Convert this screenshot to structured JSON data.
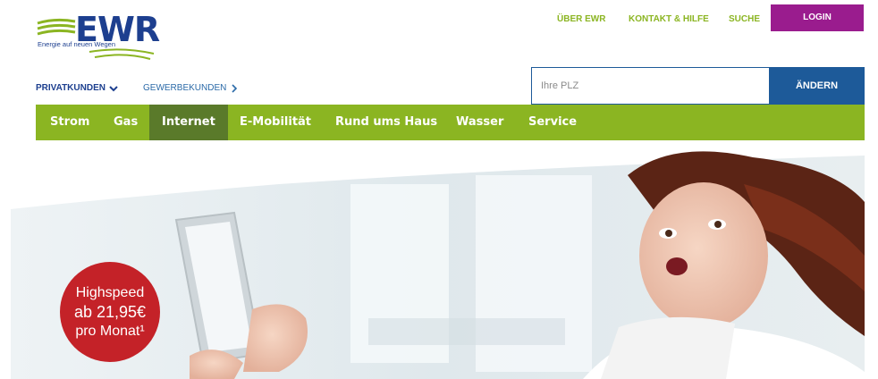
{
  "logo": {
    "brand": "EWR",
    "tagline": "Energie auf neuen Wegen"
  },
  "toplinks": {
    "about": "ÜBER EWR",
    "contact": "KONTAKT & HILFE",
    "search": "SUCHE",
    "login": "LOGIN"
  },
  "customer_switch": {
    "private": "PRIVATKUNDEN",
    "business": "GEWERBEKUNDEN"
  },
  "plz": {
    "placeholder": "Ihre PLZ",
    "button": "ÄNDERN"
  },
  "nav": {
    "items": [
      {
        "label": "Strom"
      },
      {
        "label": "Gas"
      },
      {
        "label": "Internet"
      },
      {
        "label": "E-Mobilität"
      },
      {
        "label": "Rund ums Haus"
      },
      {
        "label": "Wasser"
      },
      {
        "label": "Service"
      }
    ],
    "active": "Internet"
  },
  "hero": {
    "badge": {
      "line1": "Highspeed",
      "line2": "ab 21,95€",
      "line3": "pro Monat¹"
    }
  },
  "colors": {
    "brand_blue": "#1d3f8f",
    "green": "#8bb522",
    "green_active": "#5a7a2a",
    "login_purple": "#9a1c8e",
    "plz_blue": "#1d5a99",
    "badge_red": "#c42228"
  }
}
